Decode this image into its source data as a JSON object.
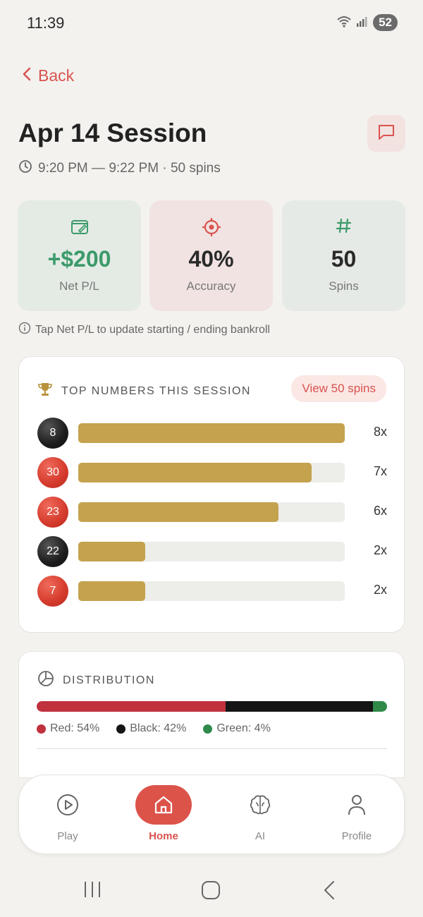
{
  "status_bar": {
    "time": "11:39",
    "battery": "52"
  },
  "header": {
    "back_label": "Back",
    "title": "Apr 14 Session",
    "meta": "9:20 PM — 9:22 PM · 50 spins"
  },
  "stats": [
    {
      "value": "+$200",
      "label": "Net P/L",
      "icon": "wallet-icon",
      "color": "#3c9a6b"
    },
    {
      "value": "40%",
      "label": "Accuracy",
      "icon": "target-icon",
      "color": "#d9534f"
    },
    {
      "value": "50",
      "label": "Spins",
      "icon": "hash-icon",
      "color": "#3c9a6b"
    }
  ],
  "hint": "Tap Net P/L to update starting / ending bankroll",
  "top_numbers": {
    "heading": "TOP NUMBERS THIS SESSION",
    "view_button": "View 50 spins",
    "rows": [
      {
        "number": "8",
        "color": "black",
        "count": "8x",
        "fraction": 1.0
      },
      {
        "number": "30",
        "color": "red",
        "count": "7x",
        "fraction": 0.875
      },
      {
        "number": "23",
        "color": "red",
        "count": "6x",
        "fraction": 0.75
      },
      {
        "number": "22",
        "color": "black",
        "count": "2x",
        "fraction": 0.25
      },
      {
        "number": "7",
        "color": "red",
        "count": "2x",
        "fraction": 0.25
      }
    ]
  },
  "distribution": {
    "heading": "DISTRIBUTION",
    "segments": [
      {
        "label": "Red: 54%",
        "percent": 54,
        "color": "#c0313d"
      },
      {
        "label": "Black: 42%",
        "percent": 42,
        "color": "#151515"
      },
      {
        "label": "Green: 4%",
        "percent": 4,
        "color": "#2f8a4a"
      }
    ]
  },
  "bottom_nav": {
    "items": [
      {
        "label": "Play",
        "icon": "play-icon",
        "active": false
      },
      {
        "label": "Home",
        "icon": "home-icon",
        "active": true
      },
      {
        "label": "AI",
        "icon": "brain-icon",
        "active": false
      },
      {
        "label": "Profile",
        "icon": "profile-icon",
        "active": false
      }
    ]
  },
  "colors": {
    "accent": "#d9534f",
    "gold": "#c4a24e",
    "positive": "#3c9a6b"
  }
}
